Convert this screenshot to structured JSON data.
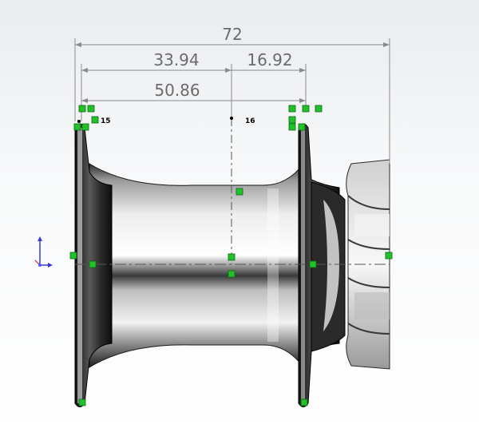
{
  "dimensions": {
    "overall": "72",
    "left_span": "33.94",
    "right_span": "16.92",
    "inner_span": "50.86"
  },
  "point_tags": {
    "left_point": "15",
    "center_point": "16"
  },
  "colors": {
    "dimension_text": "#6b6b6b",
    "dimension_line": "#8a8a8a",
    "relation_box": "#22c12a",
    "triad_x": "#d02020",
    "triad_y": "#3a3ad0",
    "centerline": "#555555"
  },
  "icons": {
    "relation_marker": "green-square-icon",
    "coordinate_triad": "triad-icon"
  }
}
